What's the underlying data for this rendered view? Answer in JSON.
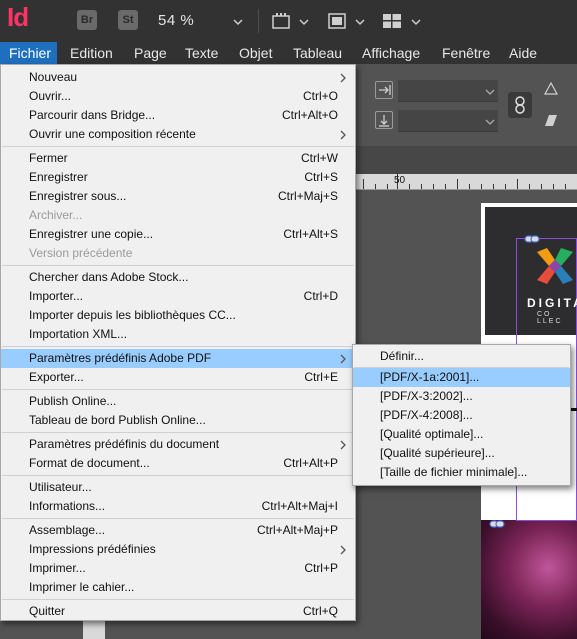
{
  "app": {
    "logo": "Id",
    "bridge_label": "Br",
    "stock_label": "St",
    "zoom": "54 %"
  },
  "menubar": {
    "items": [
      "Fichier",
      "Edition",
      "Page",
      "Texte",
      "Objet",
      "Tableau",
      "Affichage",
      "Fenêtre",
      "Aide"
    ],
    "active": "Fichier"
  },
  "ruler": {
    "label": "50"
  },
  "document": {
    "brand": "DIGITA",
    "tagline": "CO LLEC"
  },
  "fichier_menu": {
    "groups": [
      [
        {
          "label": "Nouveau",
          "shortcut": "",
          "submenu": true
        },
        {
          "label": "Ouvrir...",
          "shortcut": "Ctrl+O"
        },
        {
          "label": "Parcourir dans Bridge...",
          "shortcut": "Ctrl+Alt+O"
        },
        {
          "label": "Ouvrir une composition récente",
          "shortcut": "",
          "submenu": true
        }
      ],
      [
        {
          "label": "Fermer",
          "shortcut": "Ctrl+W"
        },
        {
          "label": "Enregistrer",
          "shortcut": "Ctrl+S"
        },
        {
          "label": "Enregistrer sous...",
          "shortcut": "Ctrl+Maj+S"
        },
        {
          "label": "Archiver...",
          "shortcut": "",
          "disabled": true
        },
        {
          "label": "Enregistrer une copie...",
          "shortcut": "Ctrl+Alt+S"
        },
        {
          "label": "Version précédente",
          "shortcut": "",
          "disabled": true
        }
      ],
      [
        {
          "label": "Chercher dans Adobe Stock...",
          "shortcut": ""
        },
        {
          "label": "Importer...",
          "shortcut": "Ctrl+D"
        },
        {
          "label": "Importer depuis les bibliothèques CC...",
          "shortcut": ""
        },
        {
          "label": "Importation XML...",
          "shortcut": ""
        }
      ],
      [
        {
          "label": "Paramètres prédéfinis Adobe PDF",
          "shortcut": "",
          "submenu": true,
          "highlighted": true
        },
        {
          "label": "Exporter...",
          "shortcut": "Ctrl+E"
        }
      ],
      [
        {
          "label": "Publish Online...",
          "shortcut": ""
        },
        {
          "label": "Tableau de bord Publish Online...",
          "shortcut": ""
        }
      ],
      [
        {
          "label": "Paramètres prédéfinis du document",
          "shortcut": "",
          "submenu": true
        },
        {
          "label": "Format de document...",
          "shortcut": "Ctrl+Alt+P"
        }
      ],
      [
        {
          "label": "Utilisateur...",
          "shortcut": ""
        },
        {
          "label": "Informations...",
          "shortcut": "Ctrl+Alt+Maj+I"
        }
      ],
      [
        {
          "label": "Assemblage...",
          "shortcut": "Ctrl+Alt+Maj+P"
        },
        {
          "label": "Impressions prédéfinies",
          "shortcut": "",
          "submenu": true
        },
        {
          "label": "Imprimer...",
          "shortcut": "Ctrl+P"
        },
        {
          "label": "Imprimer le cahier...",
          "shortcut": ""
        }
      ],
      [
        {
          "label": "Quitter",
          "shortcut": "Ctrl+Q"
        }
      ]
    ]
  },
  "pdf_submenu": {
    "items": [
      {
        "label": "Définir..."
      },
      {
        "label": "[PDF/X-1a:2001]...",
        "highlighted": true
      },
      {
        "label": "[PDF/X-3:2002]..."
      },
      {
        "label": "[PDF/X-4:2008]..."
      },
      {
        "label": "[Qualité optimale]..."
      },
      {
        "label": "[Qualité supérieure]..."
      },
      {
        "label": "[Taille de fichier minimale]..."
      }
    ],
    "separator_after": 0
  }
}
